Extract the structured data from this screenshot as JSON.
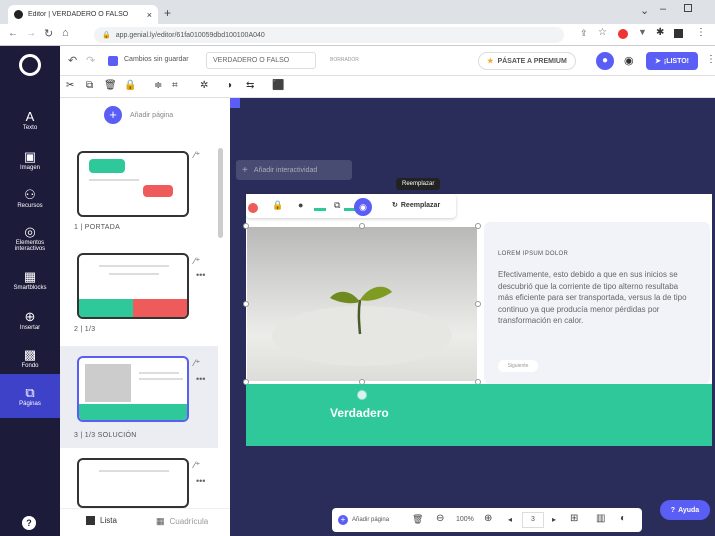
{
  "browser": {
    "tab_title": "Editor | VERDADERO O FALSO",
    "tab_close": "×",
    "new_tab": "+",
    "url": "app.genial.ly/editor/61fa010059dbd100100A040"
  },
  "toolbar": {
    "autosave": "Cambios sin guardar",
    "doc_title": "VERDADERO O FALSO",
    "small_badge": "BORRADOR",
    "premium": "PÁSATE A PREMIUM",
    "ready": "¡LISTO!"
  },
  "nav": [
    {
      "icon": "A",
      "label": "Texto"
    },
    {
      "icon": "▣",
      "label": "Imagen"
    },
    {
      "icon": "⚇",
      "label": "Recursos"
    },
    {
      "icon": "◎",
      "label": "Elementos interactivos"
    },
    {
      "icon": "▦",
      "label": "Smartblocks"
    },
    {
      "icon": "⊕",
      "label": "Insertar"
    },
    {
      "icon": "▩",
      "label": "Fondo"
    },
    {
      "icon": "⧉",
      "label": "Páginas"
    }
  ],
  "panel": {
    "add_page": "Añadir página",
    "pages": [
      {
        "label": "1 | PORTADA"
      },
      {
        "label": "2 | 1/3"
      },
      {
        "label": "3 | 1/3 SOLUCIÓN"
      }
    ],
    "view_list": "Lista",
    "view_grid": "Cuadrícula"
  },
  "canvas": {
    "add_interactive": "Añadir interactividad",
    "tooltip": "Reemplazar",
    "replace": "Reemplazar",
    "slide_heading": "LOREM IPSUM DOLOR",
    "slide_body": "Efectivamente, esto debido a que en sus inicios se descubrió que la corriente de tipo alterno resultaba más eficiente para ser transportada, versus la de tipo continuo ya que producía menor pérdidas por transformación en calor.",
    "slide_small_btn": "Siguiente",
    "banner_text": "Verdadero"
  },
  "bottom": {
    "add_page": "Añadir página",
    "zoom": "100%",
    "page_num": "3",
    "help": "Ayuda"
  },
  "colors": {
    "nav_bg": "#1c1b3a",
    "canvas_bg": "#2a2d5a",
    "accent_blue": "#5b5ef4",
    "green": "#2ec89a",
    "red": "#ef5a5a"
  }
}
